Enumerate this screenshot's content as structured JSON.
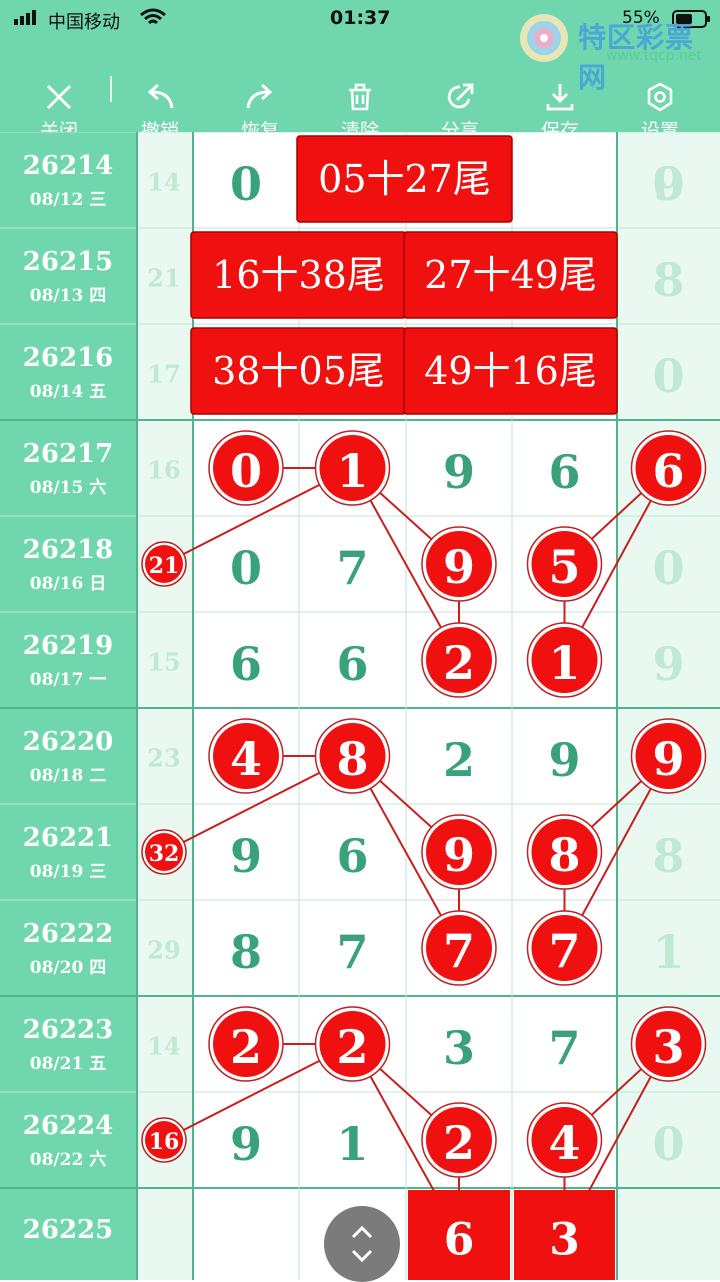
{
  "status_bar": {
    "carrier": "中国移动",
    "time": "01:37",
    "battery": "55%"
  },
  "toolbar": {
    "items": [
      {
        "label": "关闭",
        "icon": "close-icon"
      },
      {
        "label": "撤销",
        "icon": "undo-icon"
      },
      {
        "label": "恢复",
        "icon": "redo-icon"
      },
      {
        "label": "清除",
        "icon": "trash-icon"
      },
      {
        "label": "分享",
        "icon": "share-icon"
      },
      {
        "label": "保存",
        "icon": "download-icon"
      },
      {
        "label": "设置",
        "icon": "settings-icon"
      }
    ]
  },
  "logo": {
    "text": "特区彩票网",
    "url": "www.tqcp.net"
  },
  "colors": {
    "teal": "#6fd6ad",
    "light_teal": "#e9f9f1",
    "digit_green": "#3aa27a",
    "faint_digit": "#bfe9d5",
    "red": "#f01010",
    "line_red": "#c81e1e"
  },
  "rows": [
    {
      "id": "26214",
      "date": "08/12 三",
      "sum": "14",
      "digits": [
        "0",
        "",
        "",
        "",
        "9",
        "0"
      ]
    },
    {
      "id": "26215",
      "date": "08/13 四",
      "sum": "21",
      "digits": [
        "",
        "",
        "",
        "",
        "",
        "8"
      ]
    },
    {
      "id": "26216",
      "date": "08/14 五",
      "sum": "17",
      "digits": [
        "",
        "",
        "",
        "",
        "",
        "0"
      ]
    },
    {
      "id": "26217",
      "date": "08/15 六",
      "sum": "16",
      "digits": [
        "0",
        "1",
        "9",
        "6",
        "6",
        ""
      ]
    },
    {
      "id": "26218",
      "date": "08/16 日",
      "sum": "21",
      "digits": [
        "0",
        "7",
        "9",
        "5",
        "0",
        ""
      ]
    },
    {
      "id": "26219",
      "date": "08/17 一",
      "sum": "15",
      "digits": [
        "6",
        "6",
        "2",
        "1",
        "9",
        ""
      ]
    },
    {
      "id": "26220",
      "date": "08/18 二",
      "sum": "23",
      "digits": [
        "4",
        "8",
        "2",
        "9",
        "9",
        ""
      ]
    },
    {
      "id": "26221",
      "date": "08/19 三",
      "sum": "32",
      "digits": [
        "9",
        "6",
        "9",
        "8",
        "8",
        ""
      ]
    },
    {
      "id": "26222",
      "date": "08/20 四",
      "sum": "29",
      "digits": [
        "8",
        "7",
        "7",
        "7",
        "1",
        ""
      ]
    },
    {
      "id": "26223",
      "date": "08/21 五",
      "sum": "14",
      "digits": [
        "2",
        "2",
        "3",
        "7",
        "3",
        ""
      ]
    },
    {
      "id": "26224",
      "date": "08/22 六",
      "sum": "16",
      "digits": [
        "9",
        "1",
        "2",
        "4",
        "0",
        ""
      ]
    },
    {
      "id": "26225",
      "date": "",
      "sum": "",
      "digits": [
        "",
        "",
        "6",
        "3",
        "",
        ""
      ]
    }
  ],
  "banners": [
    {
      "row": 0,
      "col": 1,
      "span": 2,
      "text": "05十27尾"
    },
    {
      "row": 1,
      "col": 0,
      "span": 2,
      "text": "16十38尾"
    },
    {
      "row": 1,
      "col": 2,
      "span": 2,
      "text": "27十49尾"
    },
    {
      "row": 2,
      "col": 0,
      "span": 2,
      "text": "38十05尾"
    },
    {
      "row": 2,
      "col": 2,
      "span": 2,
      "text": "49十16尾"
    }
  ],
  "circles": [
    {
      "row": 3,
      "col": 0,
      "text": "0"
    },
    {
      "row": 3,
      "col": 1,
      "text": "1"
    },
    {
      "row": 3,
      "col": 4,
      "text": "6"
    },
    {
      "row": 4,
      "col": 2,
      "text": "9"
    },
    {
      "row": 4,
      "col": 3,
      "text": "5"
    },
    {
      "row": 5,
      "col": 2,
      "text": "2"
    },
    {
      "row": 5,
      "col": 3,
      "text": "1"
    },
    {
      "row": 6,
      "col": 0,
      "text": "4"
    },
    {
      "row": 6,
      "col": 1,
      "text": "8"
    },
    {
      "row": 6,
      "col": 4,
      "text": "9"
    },
    {
      "row": 7,
      "col": 2,
      "text": "9"
    },
    {
      "row": 7,
      "col": 3,
      "text": "8"
    },
    {
      "row": 8,
      "col": 2,
      "text": "7"
    },
    {
      "row": 8,
      "col": 3,
      "text": "7"
    },
    {
      "row": 9,
      "col": 0,
      "text": "2"
    },
    {
      "row": 9,
      "col": 1,
      "text": "2"
    },
    {
      "row": 9,
      "col": 4,
      "text": "3"
    },
    {
      "row": 10,
      "col": 2,
      "text": "2"
    },
    {
      "row": 10,
      "col": 3,
      "text": "4"
    }
  ],
  "sum_circles": [
    {
      "row": 4,
      "text": "21"
    },
    {
      "row": 7,
      "text": "32"
    },
    {
      "row": 10,
      "text": "16"
    }
  ],
  "red_blocks": [
    {
      "row": 11,
      "col": 2,
      "text": "6"
    },
    {
      "row": 11,
      "col": 3,
      "text": "3"
    }
  ],
  "connections": [
    [
      [
        3,
        0
      ],
      [
        3,
        1
      ]
    ],
    [
      [
        3,
        1
      ],
      [
        4,
        -1
      ]
    ],
    [
      [
        3,
        1
      ],
      [
        4,
        2
      ]
    ],
    [
      [
        4,
        2
      ],
      [
        5,
        2
      ]
    ],
    [
      [
        3,
        4
      ],
      [
        4,
        3
      ]
    ],
    [
      [
        4,
        3
      ],
      [
        5,
        3
      ]
    ],
    [
      [
        5,
        3
      ],
      [
        3,
        4
      ]
    ],
    [
      [
        3,
        1
      ],
      [
        5,
        2
      ]
    ],
    [
      [
        6,
        0
      ],
      [
        6,
        1
      ]
    ],
    [
      [
        6,
        1
      ],
      [
        7,
        -1
      ]
    ],
    [
      [
        6,
        1
      ],
      [
        7,
        2
      ]
    ],
    [
      [
        6,
        1
      ],
      [
        8,
        2
      ]
    ],
    [
      [
        7,
        2
      ],
      [
        8,
        2
      ]
    ],
    [
      [
        6,
        4
      ],
      [
        7,
        3
      ]
    ],
    [
      [
        7,
        3
      ],
      [
        8,
        3
      ]
    ],
    [
      [
        8,
        3
      ],
      [
        6,
        4
      ]
    ],
    [
      [
        9,
        0
      ],
      [
        9,
        1
      ]
    ],
    [
      [
        9,
        1
      ],
      [
        10,
        -1
      ]
    ],
    [
      [
        9,
        1
      ],
      [
        10,
        2
      ]
    ],
    [
      [
        9,
        1
      ],
      [
        11,
        2
      ]
    ],
    [
      [
        10,
        2
      ],
      [
        11,
        2
      ]
    ],
    [
      [
        9,
        4
      ],
      [
        10,
        3
      ]
    ],
    [
      [
        10,
        3
      ],
      [
        11,
        3
      ]
    ],
    [
      [
        11,
        3
      ],
      [
        9,
        4
      ]
    ]
  ],
  "fab": {
    "icon": "expand-collapse-icon"
  }
}
